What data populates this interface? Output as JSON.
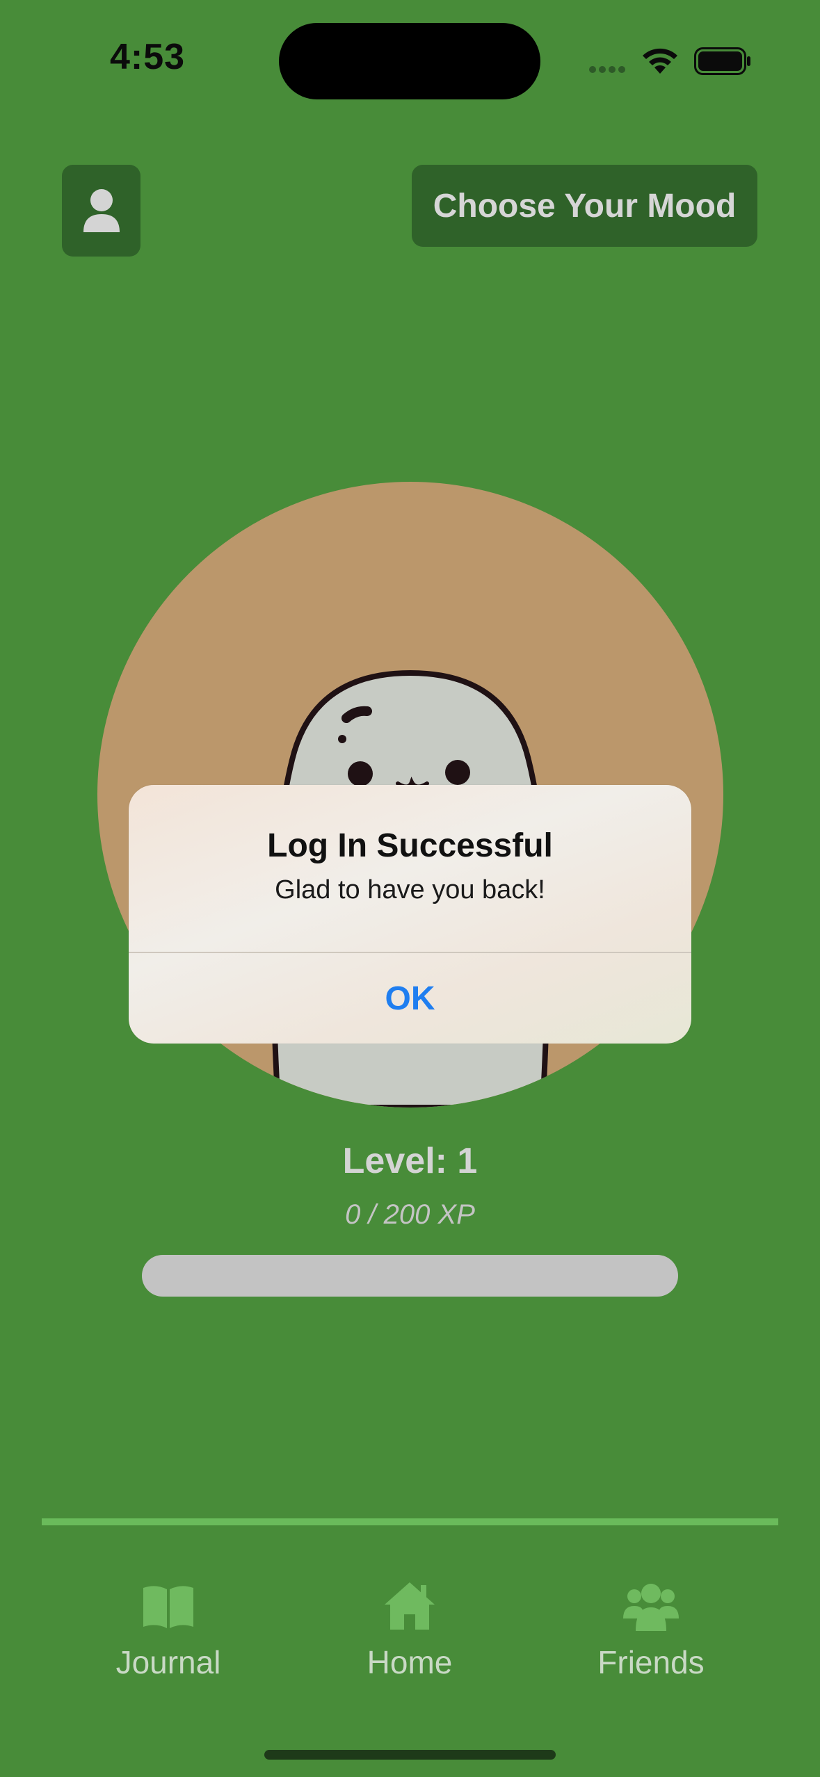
{
  "status_bar": {
    "time": "4:53"
  },
  "header": {
    "profile_icon": "person-icon",
    "mood_button_label": "Choose Your Mood"
  },
  "pet": {
    "level_label": "Level: 1",
    "xp_label": "0 / 200 XP",
    "xp_progress": 0
  },
  "alert": {
    "title": "Log In Successful",
    "message": "Glad to have you back!",
    "ok_label": "OK"
  },
  "tab_bar": {
    "items": [
      {
        "label": "Journal",
        "icon": "book-icon"
      },
      {
        "label": "Home",
        "icon": "house-icon"
      },
      {
        "label": "Friends",
        "icon": "people-icon"
      }
    ]
  },
  "colors": {
    "background": "#488c39",
    "button_bg": "#2f6229",
    "avatar_circle": "#bb976b",
    "alert_button": "#1f7ef0"
  }
}
